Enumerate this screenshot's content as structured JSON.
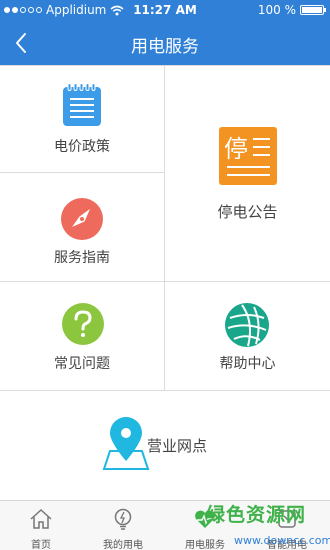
{
  "status_bar": {
    "carrier": "Applidium",
    "time": "11:27 AM",
    "battery": "100 %"
  },
  "nav": {
    "title": "用电服务",
    "back_icon": "chevron-left-icon"
  },
  "menu": {
    "price_policy": "电价政策",
    "outage_notice": "停电公告",
    "outage_icon_char": "停",
    "service_guide": "服务指南",
    "faq": "常见问题",
    "help_center": "帮助中心",
    "service_outlets": "营业网点"
  },
  "tabs": [
    {
      "label": "首页",
      "icon": "home-icon"
    },
    {
      "label": "我的用电",
      "icon": "lightbulb-icon"
    },
    {
      "label": "用电服务",
      "icon": "heart-pulse-icon"
    },
    {
      "label": "智能用电",
      "icon": "smart-icon"
    }
  ],
  "watermark": {
    "title": "绿色资源网",
    "url": "www.downcc.com"
  },
  "colors": {
    "primary": "#2f80d6",
    "doc_blue": "#3c9ce8",
    "compass_red": "#ee6a5c",
    "faq_green": "#8cc63f",
    "help_teal": "#1aa68a",
    "outage_orange": "#f39322",
    "pin_cyan": "#20b7e0",
    "watermark_green": "#3fb24a"
  }
}
